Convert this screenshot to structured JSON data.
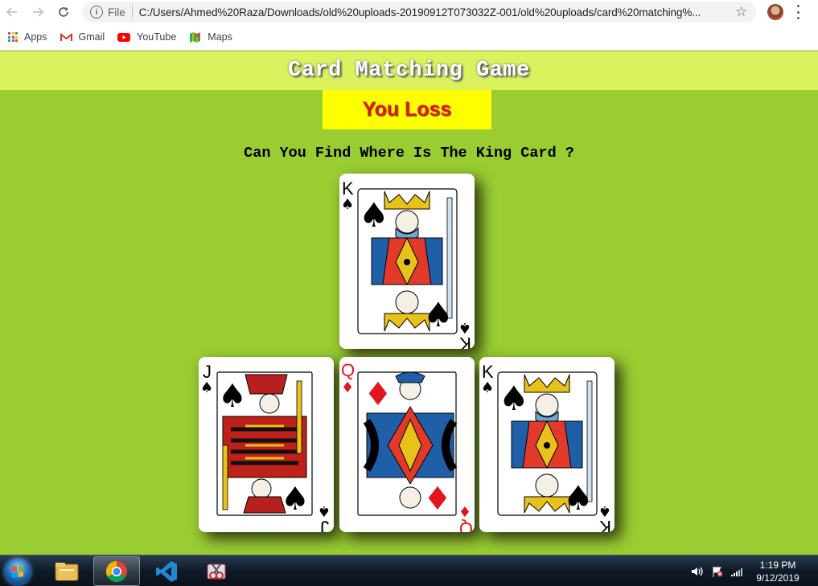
{
  "browser": {
    "url_scheme": "File",
    "url": "C:/Users/Ahmed%20Raza/Downloads/old%20uploads-20190912T073032Z-001/old%20uploads/card%20matching%...",
    "bookmarks": [
      {
        "label": "Apps",
        "icon": "apps-grid-icon"
      },
      {
        "label": "Gmail",
        "icon": "gmail-icon"
      },
      {
        "label": "YouTube",
        "icon": "youtube-icon"
      },
      {
        "label": "Maps",
        "icon": "maps-icon"
      }
    ]
  },
  "page": {
    "title": "Card Matching Game",
    "result": "You Loss",
    "question": "Can You Find Where Is The King Card ?",
    "cards": [
      {
        "rank": "K",
        "suit": "spades",
        "position": "top"
      },
      {
        "rank": "J",
        "suit": "spades",
        "position": "bottom-left"
      },
      {
        "rank": "Q",
        "suit": "diamonds",
        "position": "bottom-middle"
      },
      {
        "rank": "K",
        "suit": "spades",
        "position": "bottom-right"
      }
    ],
    "colors": {
      "background": "#9acd32",
      "header": "#dbf25e",
      "result_box": "#ffff00",
      "result_text": "#e2161c"
    }
  },
  "taskbar": {
    "apps": [
      "windows-explorer-icon",
      "chrome-icon",
      "vscode-icon",
      "snipping-tool-icon"
    ],
    "time": "1:19 PM",
    "date": "9/12/2019"
  }
}
